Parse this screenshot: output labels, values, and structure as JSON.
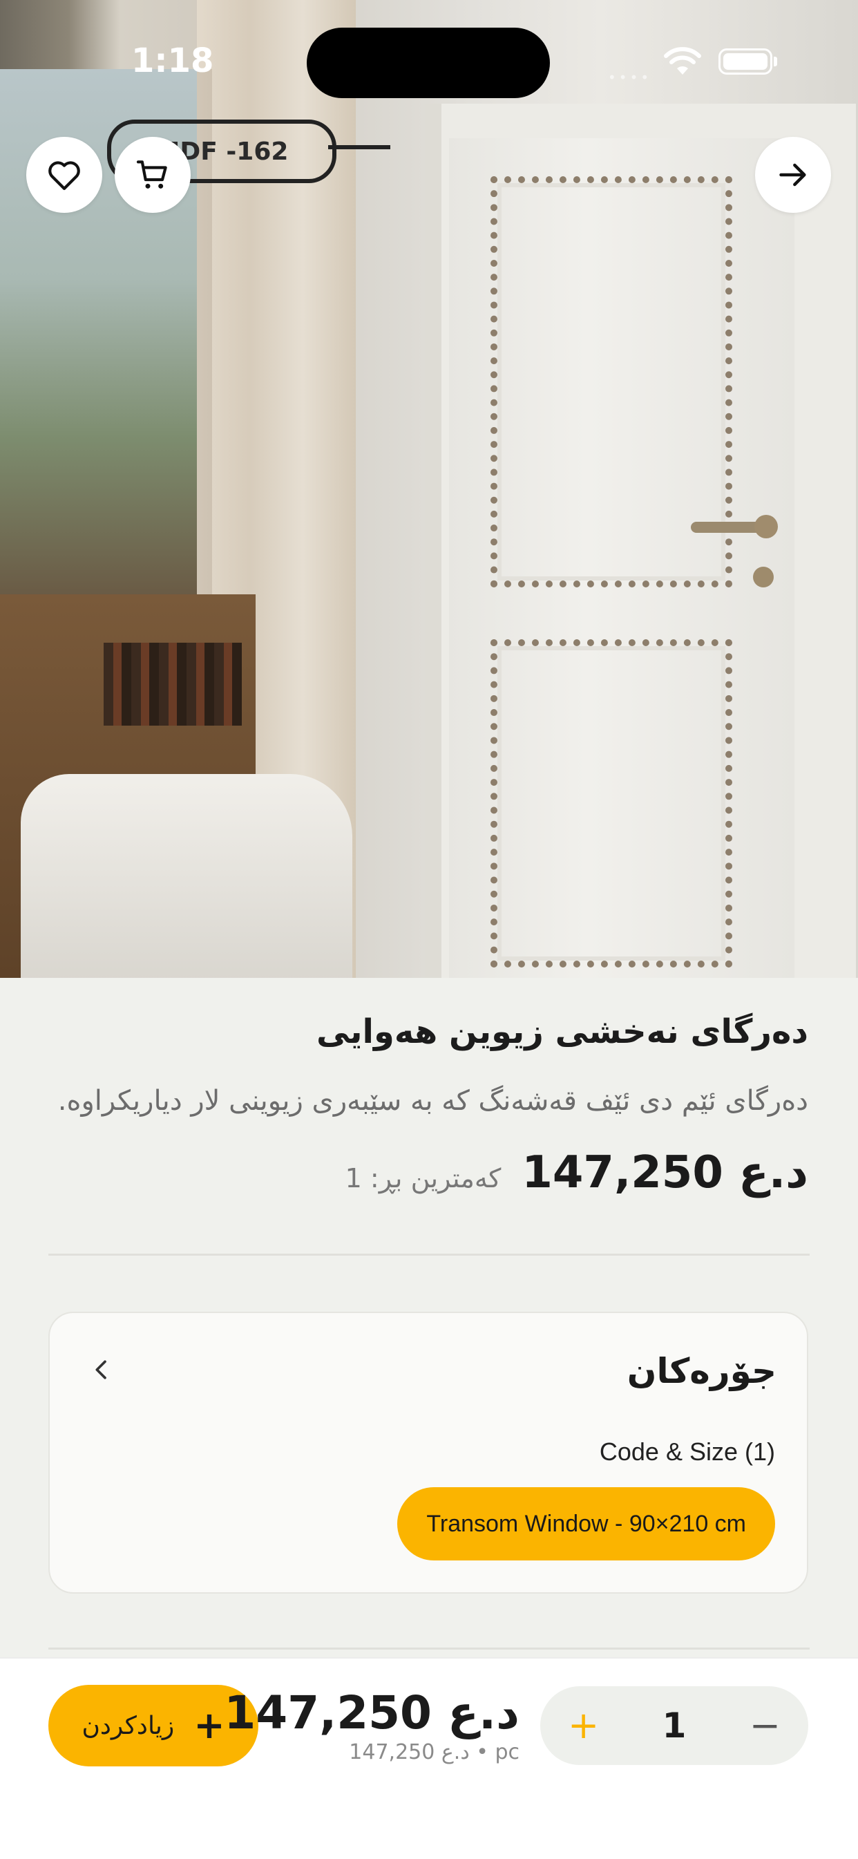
{
  "status_bar": {
    "time": "1:18"
  },
  "hero": {
    "product_label": "MDF -162"
  },
  "product": {
    "title": "دەرگای نەخشی زیوین هەوایی",
    "description": "دەرگای ئێم دی ئێف قەشەنگ کە بە سێبەری زیوینی لار دیاریکراوە.",
    "price": "147,250 د.ع",
    "min_quantity": "کەمترین بڕ: 1"
  },
  "variants": {
    "title": "جۆرەکان",
    "group_label": "Code & Size (1)",
    "selected_option": "Transom Window - 90×210 cm"
  },
  "cart_bar": {
    "add_label": "زیادکردن",
    "total_price": "147,250 د.ع",
    "unit_price": "147,250 د.ع • pc",
    "quantity": "1"
  },
  "colors": {
    "accent": "#fbb400",
    "background": "#f0f1ed"
  },
  "icons": [
    "heart-icon",
    "cart-icon",
    "arrow-right-icon",
    "chevron-left-icon",
    "plus-icon",
    "minus-icon",
    "wifi-icon",
    "battery-icon"
  ]
}
